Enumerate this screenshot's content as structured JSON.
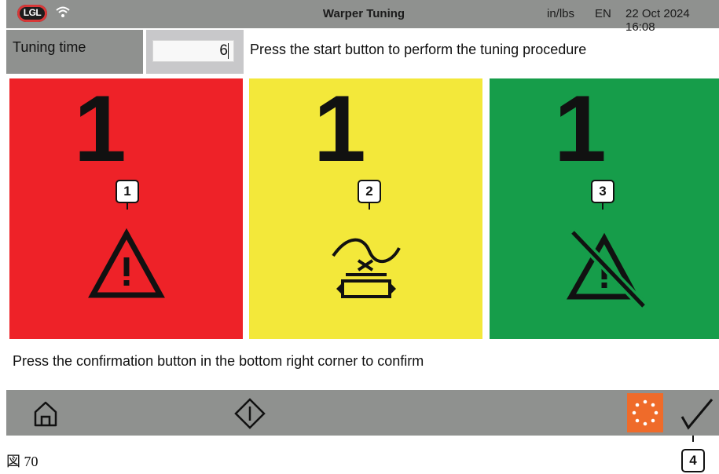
{
  "topbar": {
    "logo": "LGL",
    "title": "Warper Tuning",
    "units": "in/lbs",
    "language": "EN",
    "datetime": "22 Oct 2024 16:08"
  },
  "tuning": {
    "label": "Tuning time",
    "value": "6",
    "instruction": "Press the start button to perform the tuning procedure"
  },
  "tiles": [
    {
      "number": "1",
      "color": "#ee2228",
      "icon": "warning-triangle-icon",
      "callout": "1"
    },
    {
      "number": "1",
      "color": "#f3e83a",
      "icon": "yarn-tension-sensor-icon",
      "callout": "2"
    },
    {
      "number": "1",
      "color": "#169d4a",
      "icon": "warning-off-icon",
      "callout": "3"
    }
  ],
  "confirm_note": "Press the confirmation button in the bottom right corner to confirm",
  "bottombar": {
    "home_icon": "home-icon",
    "start_icon": "start-icon",
    "busy_icon": "busy-spinner-icon",
    "confirm_icon": "check-icon",
    "confirm_callout": "4",
    "busy_color": "#ef6b2a"
  },
  "figure_label": "図 70"
}
